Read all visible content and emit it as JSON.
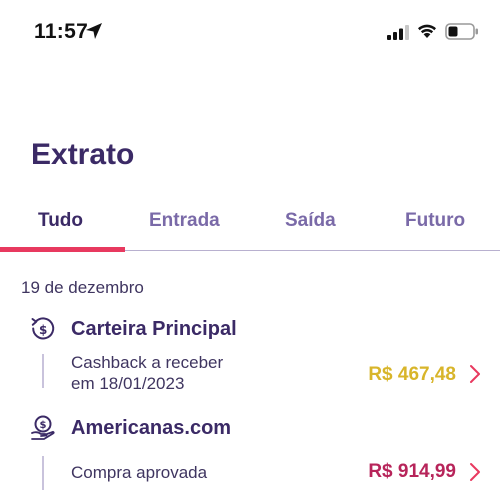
{
  "status_bar": {
    "time": "11:57"
  },
  "header": {
    "title": "Extrato"
  },
  "tabs": [
    {
      "label": "Tudo",
      "active": true
    },
    {
      "label": "Entrada",
      "active": false
    },
    {
      "label": "Saída",
      "active": false
    },
    {
      "label": "Futuro",
      "active": false
    }
  ],
  "colors": {
    "accent": "#e8395f",
    "title": "#3b2a66",
    "pending_amount": "#d8b52a",
    "debit_amount": "#b7245a"
  },
  "groups": [
    {
      "date": "19 de dezembro",
      "transactions": [
        {
          "icon": "cashback-icon",
          "title": "Carteira Principal",
          "description_line1": "Cashback a receber",
          "description_line2": "em 18/01/2023",
          "amount": "R$ 467,48"
        },
        {
          "icon": "money-hand-icon",
          "title": "Americanas.com",
          "description_line1": "Compra aprovada",
          "amount": "R$ 914,99"
        }
      ]
    }
  ]
}
